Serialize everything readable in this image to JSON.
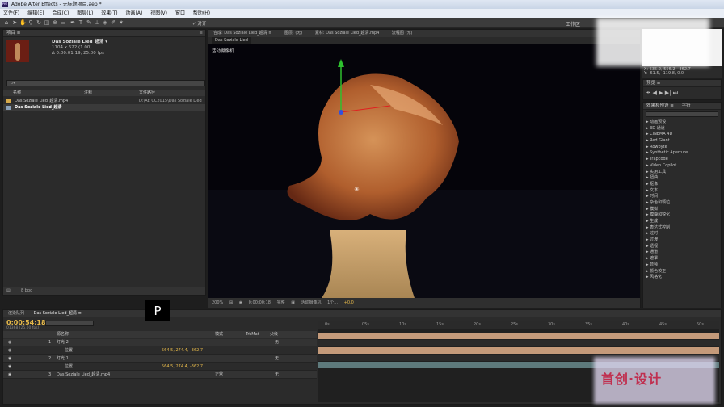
{
  "titlebar": {
    "icon": "Ae",
    "title": "Adobe After Effects - 无标题项目.aep *"
  },
  "menu": [
    "文件(F)",
    "编辑(E)",
    "合成(C)",
    "图层(L)",
    "效果(T)",
    "动画(A)",
    "视图(V)",
    "窗口",
    "帮助(H)"
  ],
  "toolbar": {
    "snap_label": "✓ 对齐",
    "workspace_label": "工作区"
  },
  "project": {
    "tab": "项目 ≡",
    "selected_name": "Das Soziale Lied_超清 ▾",
    "info_lines": [
      "1104 x 622 (1.00)",
      "Δ 0:00:01:19, 25.00 fps"
    ],
    "search_placeholder": "ρ▾",
    "columns": {
      "name": "名称",
      "comment": "注释",
      "path": "文件路径"
    },
    "rows": [
      {
        "name": "Das Soziale Lied_超清.mp4",
        "path": "D:\\AE CC2015\\Das Soziale Lied_"
      },
      {
        "name": "Das Soziale Lied_超清",
        "path": ""
      }
    ],
    "bpc": "8 bpc"
  },
  "viewer": {
    "tab": "合成: Das Soziale Lied_超清 ≡",
    "layer_tab": "图层: (无)",
    "footage_tab": "素材: Das Soziale Lied_超清.mp4",
    "flow_tab": "流程图 (无)",
    "comp_subtab": "Das Soziale Lied",
    "camera_label": "活动摄像机",
    "zoom": "200%",
    "timecode": "0:00:00:18",
    "resolution": "完整",
    "camera_select": "活动摄像机",
    "views": "1个...",
    "exposure": "+0.0"
  },
  "info": {
    "lines": [
      "X: 535.2, 556.2, -362.7",
      "Y: -61.5, -119.8, 0.0"
    ]
  },
  "preview": {
    "tab": "预览 ≡"
  },
  "effects": {
    "tab": "效果和预设 ≡",
    "tab2": "字符",
    "items": [
      "▸ 动画预设",
      "▸ 3D 通道",
      "▸ CINEMA 4D",
      "▸ Red Giant",
      "▸ Rowbyte",
      "▸ Synthetic Aperture",
      "▸ Trapcode",
      "▸ Video Copilot",
      "▸ 实用工具",
      "▸ 扭曲",
      "▸ 抠像",
      "▸ 文本",
      "▸ 时间",
      "▸ 杂色和颗粒",
      "▸ 模拟",
      "▸ 模糊和锐化",
      "▸ 生成",
      "▸ 表达式控制",
      "▸ 过时",
      "▸ 过渡",
      "▸ 透视",
      "▸ 通道",
      "▸ 遮罩",
      "▸ 音频",
      "▸ 颜色校正",
      "▸ 风格化"
    ]
  },
  "timeline": {
    "tab1": "渲染队列",
    "tab2": "Das Soziale Lied_超清 ≡",
    "timecode": "0:00:54:18",
    "timecode_sub": "01368 (25.00 fps)",
    "columns": {
      "source": "源名称",
      "mode": "模式",
      "trkmat": "TrkMat",
      "parent": "父级"
    },
    "rows": [
      {
        "num": "1",
        "name": "灯光 2",
        "value": "",
        "mode": "",
        "parent": "无"
      },
      {
        "num": "",
        "name": "位置",
        "value": "564.5, 274.4, -362.7",
        "mode": "",
        "parent": ""
      },
      {
        "num": "2",
        "name": "灯光 1",
        "value": "",
        "mode": "",
        "parent": "无"
      },
      {
        "num": "",
        "name": "位置",
        "value": "564.5, 274.4, -362.7",
        "mode": "",
        "parent": ""
      },
      {
        "num": "3",
        "name": "Das Soziale Lied_超清.mp4",
        "value": "",
        "mode": "正常",
        "parent": "无"
      }
    ],
    "ruler_ticks": [
      "0s",
      "05s",
      "10s",
      "15s",
      "20s",
      "25s",
      "30s",
      "35s",
      "40s",
      "45s",
      "50s"
    ]
  },
  "overlay": {
    "key_label": "P",
    "watermark_text": "首创·设计"
  }
}
